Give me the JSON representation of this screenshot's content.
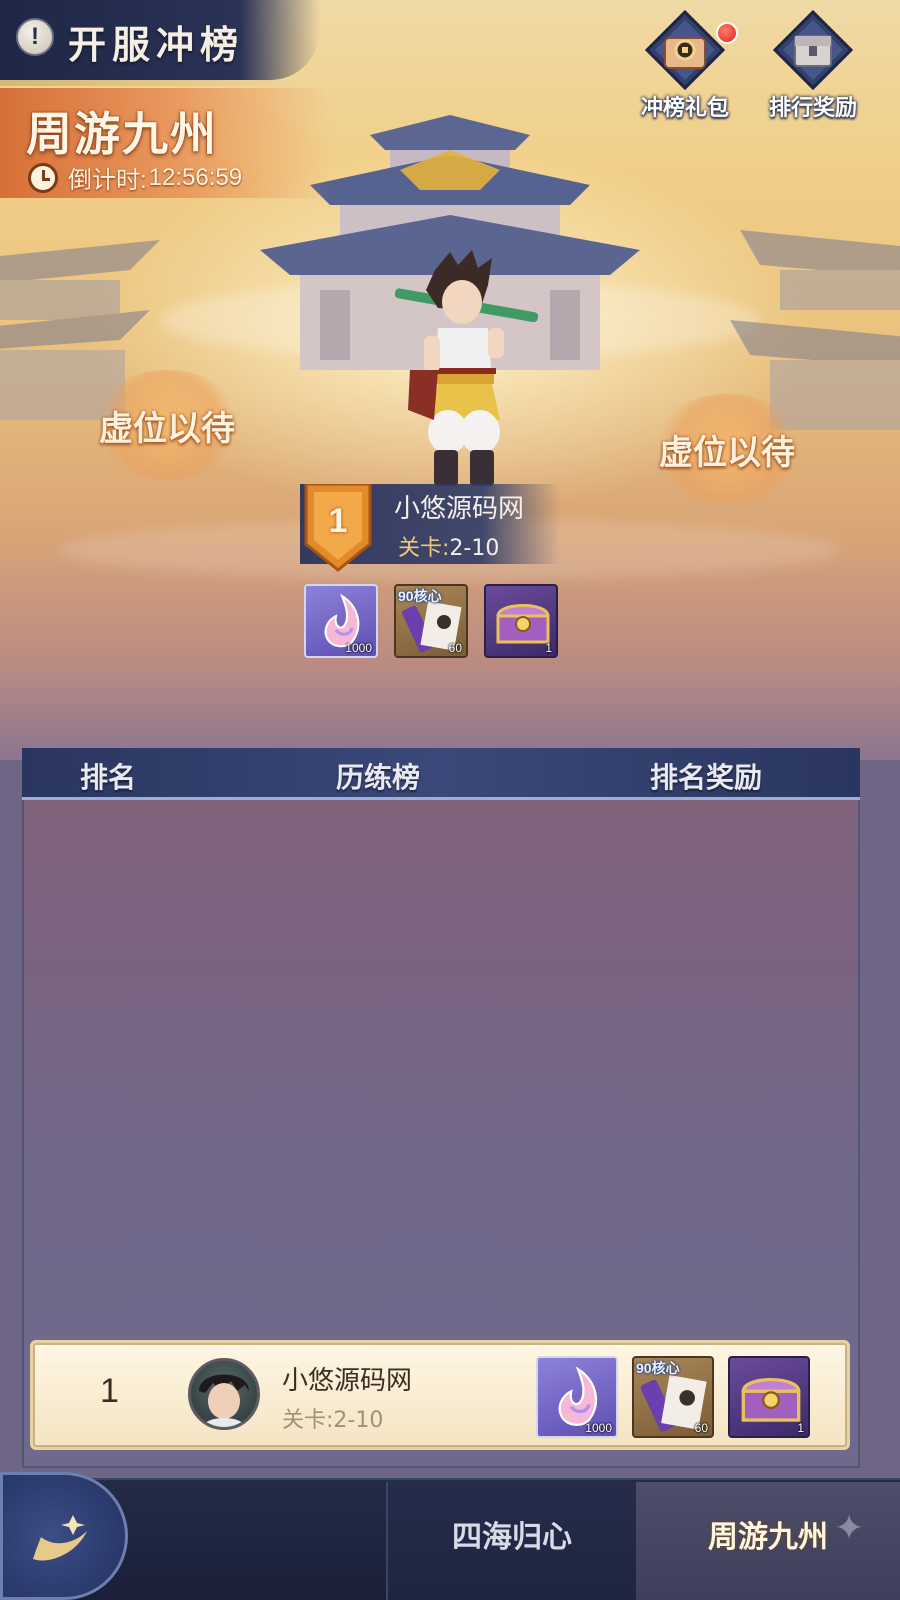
{
  "header": {
    "title": "开服冲榜",
    "info_icon": "exclamation-icon",
    "buttons": [
      {
        "label": "冲榜礼包",
        "icon": "gift-pack-icon",
        "has_notification": true
      },
      {
        "label": "排行奖励",
        "icon": "treasure-chest-icon",
        "has_notification": false
      }
    ]
  },
  "event": {
    "title": "周游九州",
    "countdown_label": "倒计时:",
    "countdown_value": "12:56:59"
  },
  "podium": {
    "vacant_left": "虚位以待",
    "vacant_right": "虚位以待",
    "first": {
      "rank": "1",
      "name": "小悠源码网",
      "level_label": "关卡:",
      "level_value": "2-10"
    },
    "rewards": [
      {
        "icon": "crystal-flame-icon",
        "qty": "1000",
        "style": "purple"
      },
      {
        "icon": "scroll-card-icon",
        "tag": "90核心",
        "qty": "60",
        "style": "brown"
      },
      {
        "icon": "treasure-chest-icon",
        "qty": "1",
        "style": "violet"
      }
    ]
  },
  "list": {
    "columns": [
      "排名",
      "历练榜",
      "排名奖励"
    ],
    "my_entry": {
      "rank": "1",
      "name": "小悠源码网",
      "level": "关卡:2-10",
      "rewards": [
        {
          "icon": "crystal-flame-icon",
          "qty": "1000"
        },
        {
          "icon": "scroll-card-icon",
          "tag": "90核心",
          "qty": "60"
        },
        {
          "icon": "treasure-chest-icon",
          "qty": "1"
        }
      ]
    }
  },
  "tabs": [
    {
      "label": "四海归心",
      "active": false
    },
    {
      "label": "周游九州",
      "active": true
    }
  ],
  "colors": {
    "accent_orange": "#d56a34",
    "panel_navy": "#2a3660",
    "notification_red": "#e0251d",
    "level_gold": "#efc87a"
  }
}
